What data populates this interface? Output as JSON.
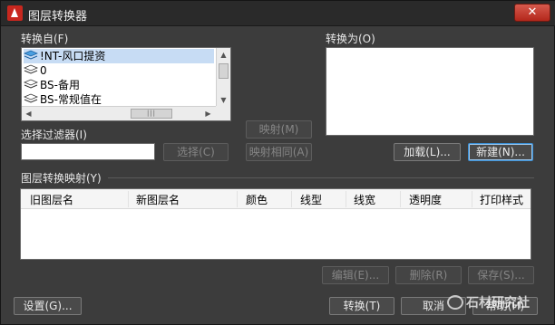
{
  "window": {
    "title": "图层转换器",
    "close_label": "✕"
  },
  "convert_from": {
    "label": "转换自(F)",
    "items": [
      {
        "name": "!NT-风口提资",
        "selected": true
      },
      {
        "name": "0"
      },
      {
        "name": "BS-备用"
      },
      {
        "name": "BS-常规值在"
      }
    ]
  },
  "filter": {
    "label": "选择过滤器(I)",
    "value": "",
    "select_label": "选择(C)"
  },
  "middle": {
    "map_label": "映射(M)",
    "map_same_label": "映射相同(A)"
  },
  "convert_to": {
    "label": "转换为(O)",
    "load_label": "加载(L)...",
    "new_label": "新建(N)..."
  },
  "mappings": {
    "label": "图层转换映射(Y)",
    "columns": [
      "旧图层名",
      "新图层名",
      "颜色",
      "线型",
      "线宽",
      "透明度",
      "打印样式"
    ],
    "edit_label": "编辑(E)...",
    "delete_label": "删除(R)",
    "save_label": "保存(S)..."
  },
  "footer": {
    "settings_label": "设置(G)...",
    "convert_label": "转换(T)",
    "cancel_label": "取消",
    "help_label": "帮助(H)"
  },
  "watermark": {
    "text": "石材研究社"
  }
}
